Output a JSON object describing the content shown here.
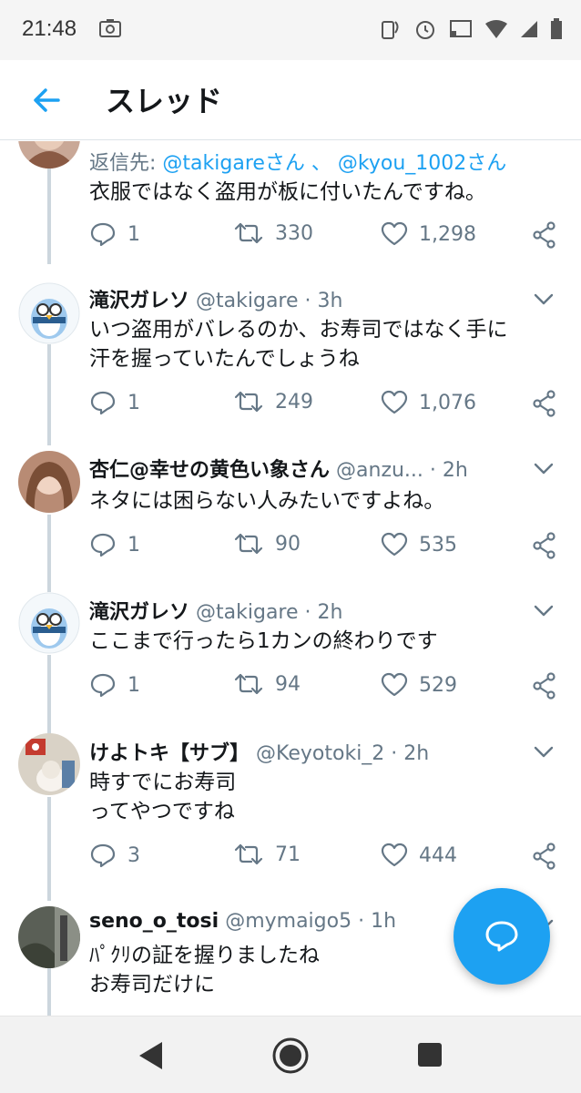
{
  "status_bar": {
    "time": "21:48"
  },
  "header": {
    "title": "スレッド"
  },
  "colors": {
    "accent": "#1da1f2",
    "text": "#14171a",
    "muted": "#657786",
    "thread_line": "#ccd6dd"
  },
  "tweets": [
    {
      "reply_prefix": "返信先: ",
      "reply_mention_1": "@takigareさん",
      "reply_sep": " 、 ",
      "reply_mention_2": "@kyou_1002さん",
      "text": "衣服ではなく盗用が板に付いたんですね。",
      "replies": "1",
      "retweets": "330",
      "likes": "1,298"
    },
    {
      "name": "滝沢ガレソ",
      "handle": "@takigare",
      "dot": " · ",
      "time": "3h",
      "text": "いつ盗用がバレるのか、お寿司ではなく手に\n汗を握っていたんでしょうね",
      "replies": "1",
      "retweets": "249",
      "likes": "1,076"
    },
    {
      "name": "杏仁@幸せの黄色い象さん",
      "handle": "@anzu...",
      "dot": " · ",
      "time": "2h",
      "text": "ネタには困らない人みたいですよね。",
      "replies": "1",
      "retweets": "90",
      "likes": "535"
    },
    {
      "name": "滝沢ガレソ",
      "handle": "@takigare",
      "dot": " · ",
      "time": "2h",
      "text": "ここまで行ったら1カンの終わりです",
      "replies": "1",
      "retweets": "94",
      "likes": "529"
    },
    {
      "name": "けよトキ【サブ】",
      "handle": "@Keyotoki_2",
      "dot": " · ",
      "time": "2h",
      "text": "時すでにお寿司\nってやつですね",
      "replies": "3",
      "retweets": "71",
      "likes": "444"
    },
    {
      "name": "seno_o_tosi",
      "handle": "@mymaigo5",
      "dot": " · ",
      "time": "1h",
      "text": "ﾊﾟｸﾘの証を握りましたね\nお寿司だけに"
    }
  ],
  "icons": {
    "back": "arrow-left-icon",
    "reply": "reply-icon",
    "retweet": "retweet-icon",
    "like": "heart-icon",
    "share": "share-icon",
    "compose": "compose-reply-icon"
  }
}
